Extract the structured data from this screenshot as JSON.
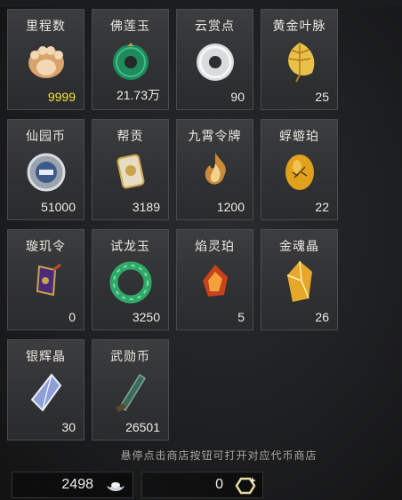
{
  "items": [
    {
      "name": "里程数",
      "count": "9999",
      "icon": "paw-icon"
    },
    {
      "name": "佛莲玉",
      "count": "21.73万",
      "icon": "jade-ring-icon"
    },
    {
      "name": "云赏点",
      "count": "90",
      "icon": "white-jade-disc-icon"
    },
    {
      "name": "黄金叶脉",
      "count": "25",
      "icon": "golden-leaf-icon"
    },
    {
      "name": "仙园币",
      "count": "51000",
      "icon": "coin-icon"
    },
    {
      "name": "帮贡",
      "count": "3189",
      "icon": "scroll-token-icon"
    },
    {
      "name": "九霄令牌",
      "count": "1200",
      "icon": "flame-token-icon"
    },
    {
      "name": "蜉蝣珀",
      "count": "22",
      "icon": "amber-insect-icon"
    },
    {
      "name": "璇玑令",
      "count": "0",
      "icon": "purple-charm-icon"
    },
    {
      "name": "试龙玉",
      "count": "3250",
      "icon": "dragon-jade-icon"
    },
    {
      "name": "焰灵珀",
      "count": "5",
      "icon": "fire-amber-icon"
    },
    {
      "name": "金魂晶",
      "count": "26",
      "icon": "gold-crystal-icon"
    },
    {
      "name": "银辉晶",
      "count": "30",
      "icon": "silver-crystal-icon"
    },
    {
      "name": "武勋币",
      "count": "26501",
      "icon": "sword-coin-icon"
    }
  ],
  "hint": "悬停点击商店按钮可打开对应代币商店",
  "currencies": [
    {
      "value": "2498",
      "icon": "silver-ingot-icon"
    },
    {
      "value": "0",
      "icon": "hexagon-token-icon"
    }
  ],
  "colors": {
    "highlight_count": "#f5e23a"
  }
}
